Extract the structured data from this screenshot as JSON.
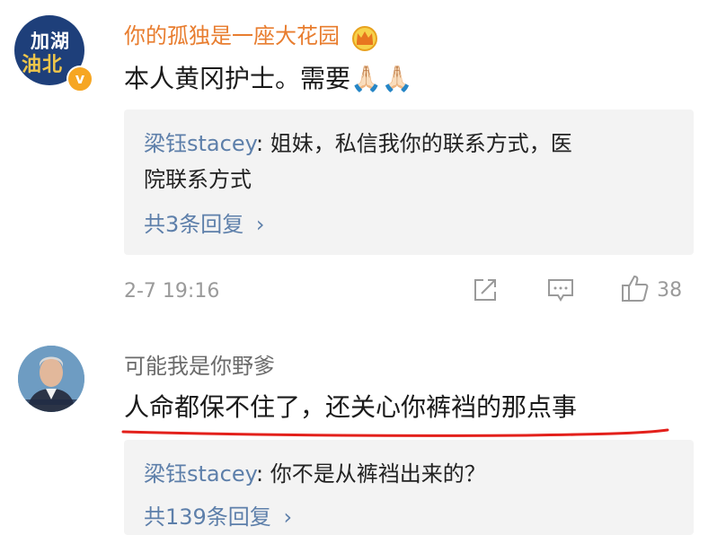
{
  "comments": [
    {
      "username": "你的孤独是一座大花园",
      "avatar_text": [
        "加湖",
        "油北"
      ],
      "verified_icon": "verified-badge-icon",
      "badge_icon": "crown-icon",
      "text": "本人黄冈护士。需要🙏🏻🙏🏻",
      "reply_preview": {
        "user": "梁钰stacey",
        "text_line1": "姐妹，私信我你的联系方式，医",
        "text_line2": "院联系方式"
      },
      "more_replies": "共3条回复",
      "timestamp": "2-7 19:16",
      "like_count": "38"
    },
    {
      "username": "可能我是你野爹",
      "text": "人命都保不住了，还关心你裤裆的那点事",
      "reply_preview": {
        "user": "梁钰stacey",
        "text": "你不是从裤裆出来的？"
      },
      "more_replies": "共139条回复"
    }
  ],
  "colors": {
    "username_highlight": "#e87d2f",
    "reply_user": "#5d7faa",
    "underline": "#e3201b",
    "reply_bg": "#f3f3f3"
  }
}
